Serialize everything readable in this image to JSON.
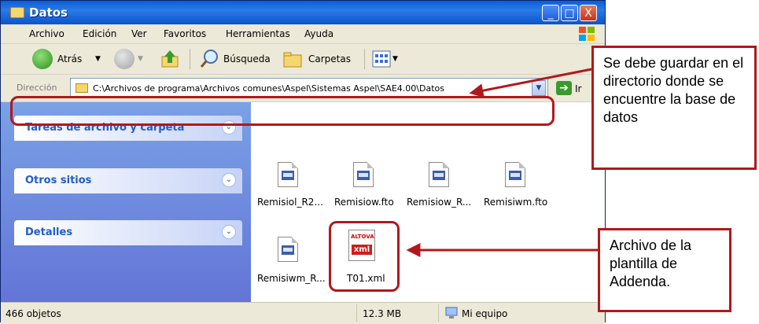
{
  "window": {
    "title": "Datos",
    "controls": [
      "_",
      "□",
      "X"
    ]
  },
  "menu": [
    "Archivo",
    "Edición",
    "Ver",
    "Favoritos",
    "Herramientas",
    "Ayuda"
  ],
  "toolbar": {
    "back": "Atrás",
    "search": "Búsqueda",
    "folders": "Carpetas"
  },
  "address": {
    "label": "Dirección",
    "value": "C:\\Archivos de programa\\Archivos comunes\\Aspel\\Sistemas Aspel\\SAE4.00\\Datos",
    "go": "Ir"
  },
  "tasks": [
    {
      "label": "Tareas de archivo y carpeta"
    },
    {
      "label": "Otros sitios"
    },
    {
      "label": "Detalles"
    }
  ],
  "files": [
    {
      "name": "Remisiol_R2..."
    },
    {
      "name": "Remisiow.fto"
    },
    {
      "name": "Remisiow_R..."
    },
    {
      "name": "Remisiwm.fto"
    },
    {
      "name": "Remisiwm_R..."
    },
    {
      "name": "T01.xml"
    }
  ],
  "xml_icon": {
    "brand": "ALTOVA",
    "tag": "xml"
  },
  "status": {
    "objects": "466 objetos",
    "size": "12.3 MB",
    "location": "Mi equipo"
  },
  "callouts": {
    "directory": "Se debe guardar en el directorio donde se encuentre la base de datos",
    "template": "Archivo de la plantilla de Addenda."
  },
  "colors": {
    "annotation": "#b1181c",
    "title_bar": "#0a5fd8",
    "task_text": "#215dc6"
  }
}
